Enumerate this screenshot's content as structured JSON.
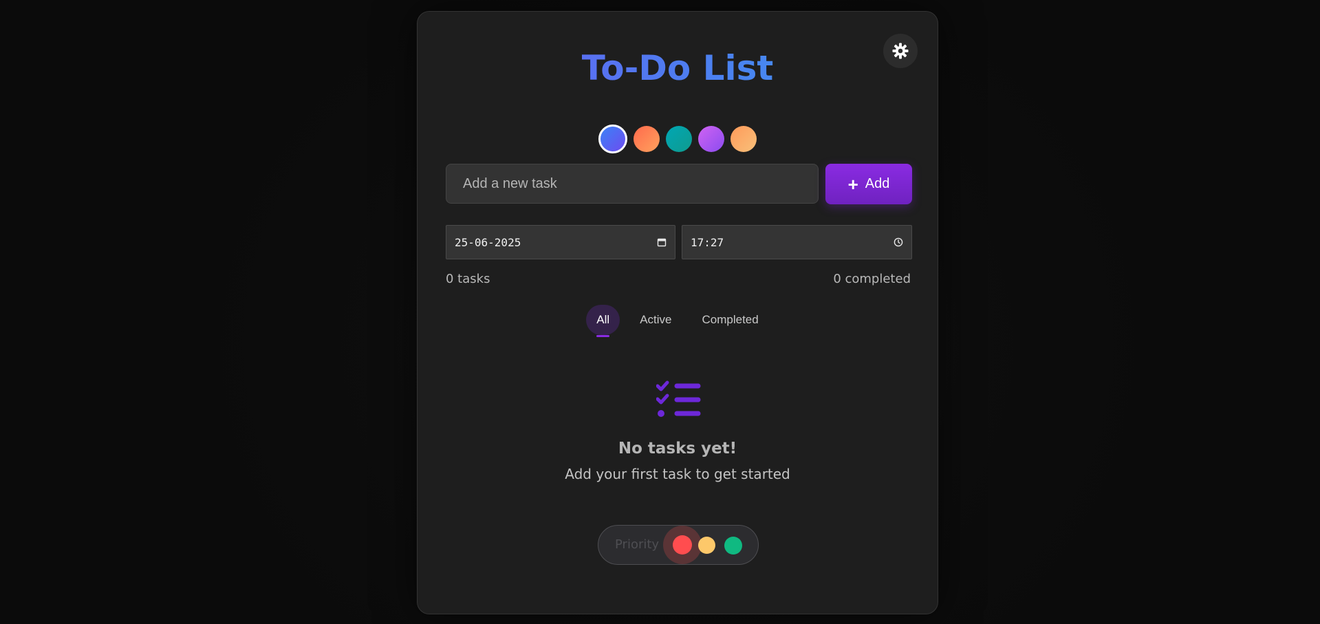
{
  "app": {
    "title": "To-Do List"
  },
  "theme_toggle": {
    "icon": "gear-icon"
  },
  "color_themes": [
    {
      "name": "blue",
      "gradient": [
        "#3b82f6",
        "#6d4cf0"
      ],
      "selected": true
    },
    {
      "name": "coral",
      "gradient": [
        "#ff6a4c",
        "#ffa25e"
      ],
      "selected": false
    },
    {
      "name": "teal",
      "gradient": [
        "#00a7b5",
        "#0f9b8e"
      ],
      "selected": false
    },
    {
      "name": "violet",
      "gradient": [
        "#d063f2",
        "#8b4cf0"
      ],
      "selected": false
    },
    {
      "name": "orange",
      "gradient": [
        "#ff9a5a",
        "#f8c07a"
      ],
      "selected": false
    }
  ],
  "new_task": {
    "placeholder": "Add a new task",
    "value": "",
    "add_label": "Add"
  },
  "date_field": {
    "value": "25-06-2025"
  },
  "time_field": {
    "value": "17:27"
  },
  "stats": {
    "tasks": "0 tasks",
    "completed": "0 completed"
  },
  "filters": [
    {
      "label": "All",
      "active": true
    },
    {
      "label": "Active",
      "active": false
    },
    {
      "label": "Completed",
      "active": false
    }
  ],
  "empty_state": {
    "icon": "checklist-icon",
    "title": "No tasks yet!",
    "subtitle": "Add your first task to get started"
  },
  "priority": {
    "label": "Priority",
    "levels": [
      {
        "name": "high",
        "color": "#ff4d4f",
        "selected": true
      },
      {
        "name": "medium",
        "color": "#fdc86a",
        "selected": false
      },
      {
        "name": "low",
        "color": "#10b981",
        "selected": false
      }
    ]
  },
  "colors": {
    "accent": "#8a2be2",
    "title_gradient": [
      "#6a5cf2",
      "#3b9cf0"
    ],
    "background": "#0c0c0c",
    "card": "#1e1e1e"
  }
}
